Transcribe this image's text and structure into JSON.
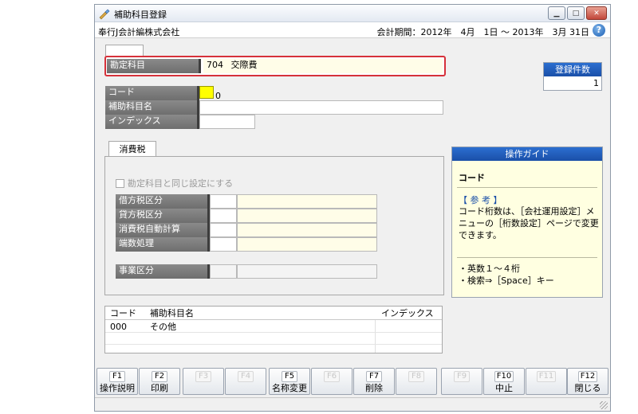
{
  "window": {
    "title": "補助科目登録",
    "company": "奉行J会計編株式会社",
    "period": "会計期間：2012年　4月　1日 ～ 2013年　3月 31日",
    "controls": {
      "minimize": "▁",
      "maximize": "□",
      "close": "✕"
    },
    "help": "?"
  },
  "account": {
    "label": "勘定科目",
    "code": "704",
    "name": "交際費"
  },
  "registration": {
    "label": "登録件数",
    "count": "1"
  },
  "fields": {
    "code_label": "コード",
    "code_value": "0",
    "name_label": "補助科目名",
    "index_label": "インデックス"
  },
  "tax": {
    "tab_label": "消費税",
    "same_setting": "勘定科目と同じ設定にする",
    "rows": [
      {
        "label": "借方税区分"
      },
      {
        "label": "貸方税区分"
      },
      {
        "label": "消費税自動計算"
      },
      {
        "label": "端数処理"
      }
    ],
    "business_label": "事業区分"
  },
  "guide": {
    "header": "操作ガイド",
    "title": "コード",
    "ref": "【 参 考 】",
    "body": "コード桁数は、［会社運用設定］メニューの［桁数設定］ページで変更できます。",
    "tips": [
      "・英数１～４桁",
      "・検索⇒［Space］キー"
    ]
  },
  "list": {
    "headers": {
      "code": "コード",
      "name": "補助科目名",
      "index": "インデックス"
    },
    "rows": [
      {
        "code": "000",
        "name": "その他",
        "index": ""
      }
    ]
  },
  "fkeys": [
    {
      "num": "F1",
      "label": "操作説明",
      "enabled": true
    },
    {
      "num": "F2",
      "label": "印刷",
      "enabled": true
    },
    {
      "num": "F3",
      "label": "",
      "enabled": false
    },
    {
      "num": "F4",
      "label": "",
      "enabled": false
    },
    {
      "num": "F5",
      "label": "名称変更",
      "enabled": true
    },
    {
      "num": "F6",
      "label": "",
      "enabled": false
    },
    {
      "num": "F7",
      "label": "削除",
      "enabled": true
    },
    {
      "num": "F8",
      "label": "",
      "enabled": false
    },
    {
      "num": "F9",
      "label": "",
      "enabled": false
    },
    {
      "num": "F10",
      "label": "中止",
      "enabled": true
    },
    {
      "num": "F11",
      "label": "",
      "enabled": false
    },
    {
      "num": "F12",
      "label": "閉じる",
      "enabled": true
    }
  ]
}
